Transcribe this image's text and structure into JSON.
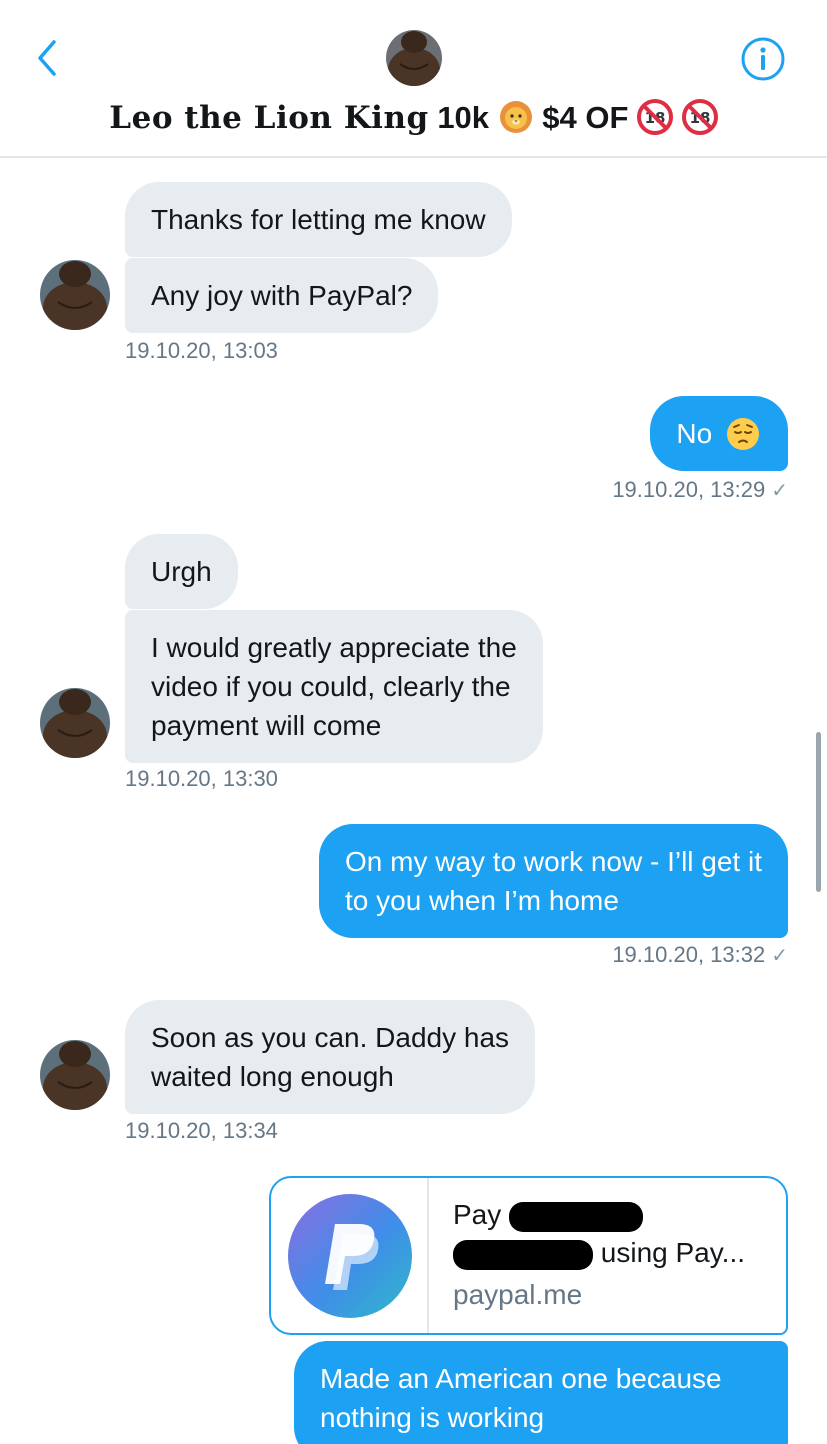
{
  "header": {
    "title_name": "𝐋𝐞𝐨 𝐭𝐡𝐞 𝐋𝐢𝐨𝐧 𝐊𝐢𝐧𝐠",
    "title_count": "10k",
    "title_price": "$4 OF",
    "emojis": [
      "lion-face-icon",
      "no-under-18-icon",
      "no-under-18-icon"
    ]
  },
  "colors": {
    "accent": "#1da1f2",
    "incoming_bubble": "#e6ecf0",
    "timestamp": "#657786"
  },
  "messages": [
    {
      "direction": "in",
      "text": "Thanks for letting me know"
    },
    {
      "direction": "in",
      "text": "Any joy with PayPal?"
    },
    {
      "direction": "in",
      "timestamp": "19.10.20, 13:03"
    },
    {
      "direction": "out",
      "text": "No",
      "emoji": "pensive-face-icon"
    },
    {
      "direction": "out",
      "timestamp": "19.10.20, 13:29"
    },
    {
      "direction": "in",
      "text": "Urgh"
    },
    {
      "direction": "in",
      "text_lines": [
        "I would greatly appreciate the",
        "video if you could, clearly the",
        "payment will come"
      ]
    },
    {
      "direction": "in",
      "timestamp": "19.10.20, 13:30"
    },
    {
      "direction": "out",
      "text_lines": [
        "On my way to work now - I’ll get it",
        "to you when I’m home"
      ]
    },
    {
      "direction": "out",
      "timestamp": "19.10.20, 13:32"
    },
    {
      "direction": "in",
      "text_lines": [
        "Soon as you can. Daddy has",
        "waited long enough"
      ]
    },
    {
      "direction": "in",
      "timestamp": "19.10.20, 13:34"
    },
    {
      "direction": "out",
      "text_lines": [
        "Made an American one because",
        "nothing is working"
      ]
    }
  ],
  "read_check": "✓",
  "link_card": {
    "title_prefix": "Pay",
    "title_suffix": "using Pay...",
    "domain": "paypal.me",
    "thumb_icon": "paypal-logo-icon"
  }
}
